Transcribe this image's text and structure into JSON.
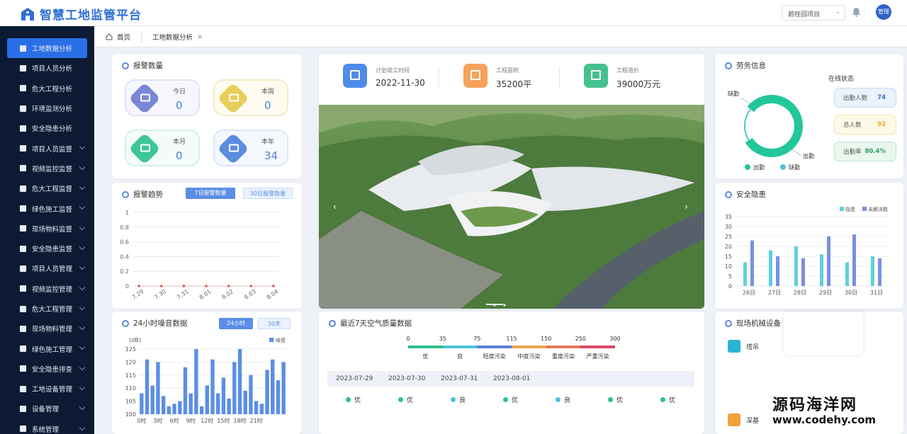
{
  "app": {
    "title": "智慧工地监管平台",
    "project_select": "碧桂园项目",
    "user": "管理"
  },
  "tabs": [
    {
      "label": "首页"
    },
    {
      "label": "工地数据分析"
    }
  ],
  "sidebar": {
    "items": [
      {
        "label": "工地数据分析",
        "active": true,
        "chevron": false
      },
      {
        "label": "项目人员分析",
        "chevron": false
      },
      {
        "label": "危大工程分析",
        "chevron": false
      },
      {
        "label": "环境监测分析",
        "chevron": false
      },
      {
        "label": "安全隐患分析",
        "chevron": false
      },
      {
        "label": "项目人员监督",
        "chevron": true
      },
      {
        "label": "视频监控监督",
        "chevron": true
      },
      {
        "label": "危大工程监督",
        "chevron": true
      },
      {
        "label": "绿色施工监督",
        "chevron": true
      },
      {
        "label": "现场物料监督",
        "chevron": true
      },
      {
        "label": "安全隐患监督",
        "chevron": true
      },
      {
        "label": "项目人员管理",
        "chevron": true
      },
      {
        "label": "视频监控管理",
        "chevron": true
      },
      {
        "label": "危大工程管理",
        "chevron": true
      },
      {
        "label": "现场物料管理",
        "chevron": true
      },
      {
        "label": "绿色施工管理",
        "chevron": true
      },
      {
        "label": "安全隐患排查",
        "chevron": true
      },
      {
        "label": "工地设备管理",
        "chevron": true
      },
      {
        "label": "设备管理",
        "chevron": true
      },
      {
        "label": "系统管理",
        "chevron": true
      }
    ]
  },
  "alarm_count": {
    "title": "报警数量",
    "items": [
      {
        "label": "今日",
        "value": "0"
      },
      {
        "label": "本周",
        "value": "0"
      },
      {
        "label": "本月",
        "value": "0"
      },
      {
        "label": "本年",
        "value": "34"
      }
    ]
  },
  "alarm_trend": {
    "title": "报警趋势",
    "btn_7": "7日报警数量",
    "btn_30": "30日报警数量",
    "chart_data": {
      "type": "line",
      "x": [
        "7.29",
        "7.30",
        "7.31",
        "8.01",
        "8.02",
        "8.03",
        "8.04"
      ],
      "values": [
        0,
        0,
        0,
        0,
        0,
        0,
        0
      ],
      "yticks": [
        "1",
        "0.8",
        "0.6",
        "0.4",
        "0.2",
        "0"
      ],
      "ylim": [
        0,
        1
      ],
      "color": "#e05a4f"
    }
  },
  "noise": {
    "title": "24小时噪音数据",
    "btn_24": "24小时",
    "btn_30": "30天",
    "unit": "(dB)",
    "legend": "噪音",
    "chart_data": {
      "type": "bar",
      "xticks": [
        "0时",
        "3时",
        "6时",
        "9时",
        "12时",
        "15时",
        "18时",
        "21时"
      ],
      "values": [
        108,
        121,
        111,
        120,
        107,
        103,
        104,
        105,
        118,
        108,
        125,
        103,
        111,
        121,
        108,
        114,
        106,
        120,
        125,
        109,
        115,
        105,
        104,
        117,
        121,
        113,
        120
      ],
      "yticks": [
        "125",
        "120",
        "115",
        "110",
        "105",
        "100"
      ],
      "ylim": [
        100,
        125
      ],
      "color": "#5b8ee6"
    }
  },
  "project_info": {
    "items": [
      {
        "label": "计划竣工时间",
        "value": "2022-11-30",
        "color": "#4f8be8"
      },
      {
        "label": "工程面积",
        "value": "35200平",
        "color": "#f5a35a"
      },
      {
        "label": "工程造价",
        "value": "39000万元",
        "color": "#45c08f"
      }
    ]
  },
  "air": {
    "title": "最近7天空气质量数据",
    "scale_values": [
      "0",
      "35",
      "75",
      "115",
      "150",
      "250",
      "300"
    ],
    "scale_labels": [
      "优",
      "良",
      "轻度污染",
      "中度污染",
      "重度污染",
      "严重污染"
    ],
    "scale_colors": [
      "#2fbf8f",
      "#4fc3dc",
      "#5a7fd6",
      "#e8a94a",
      "#e07a5a",
      "#d94a6a"
    ],
    "dates": [
      "2023-07-29",
      "2023-07-30",
      "2023-07-31",
      "2023-08-01"
    ],
    "levels": [
      "优",
      "优",
      "良",
      "优",
      "良",
      "优",
      "优"
    ],
    "level_colors": [
      "#2fbf8f",
      "#2fbf8f",
      "#4fc3dc",
      "#2fbf8f",
      "#4fc3dc",
      "#2fbf8f",
      "#2fbf8f"
    ]
  },
  "labor": {
    "title": "劳务信息",
    "online": "在线状态",
    "donut_labels": [
      "缺勤",
      "出勤"
    ],
    "chart_data": {
      "type": "pie",
      "series": [
        {
          "name": "出勤",
          "value": 74
        },
        {
          "name": "缺勤",
          "value": 18
        }
      ],
      "colors": [
        "#22c79a",
        "#4fc3dc"
      ]
    },
    "legend": [
      "出勤",
      "缺勤"
    ],
    "pills": [
      {
        "label": "出勤人数",
        "value": "74"
      },
      {
        "label": "总人数",
        "value": "92"
      },
      {
        "label": "出勤率",
        "value": "80.4%"
      }
    ]
  },
  "hazard": {
    "title": "安全隐患",
    "legend": [
      "隐患",
      "未解决数"
    ],
    "chart_data": {
      "type": "bar",
      "categories": [
        "26日",
        "27日",
        "28日",
        "29日",
        "30日",
        "31日"
      ],
      "series": [
        {
          "name": "隐患",
          "values": [
            12,
            18,
            20,
            16,
            12,
            15
          ],
          "color": "#5fd0dc"
        },
        {
          "name": "未解决数",
          "values": [
            23,
            15,
            14,
            25,
            26,
            14
          ],
          "color": "#7a8fe0"
        }
      ],
      "yticks": [
        "35",
        "30",
        "25",
        "20",
        "15",
        "10",
        "5",
        "0"
      ],
      "ylim": [
        0,
        35
      ]
    }
  },
  "machines": {
    "title": "现场机械设备",
    "items": [
      {
        "label": "塔吊"
      },
      {
        "label": "深基"
      }
    ]
  },
  "watermark": {
    "line1": "源码海洋网",
    "line2": "www.codehy.com"
  }
}
